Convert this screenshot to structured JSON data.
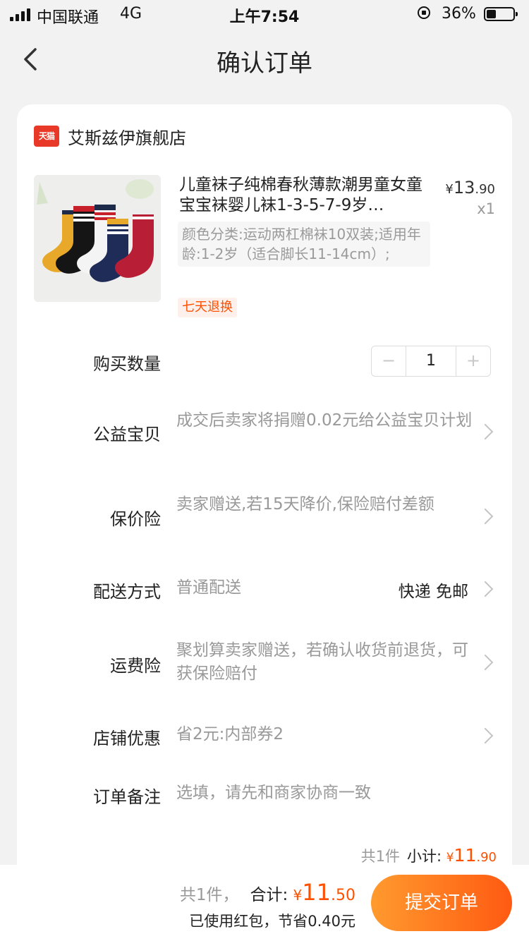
{
  "status": {
    "carrier": "中国联通",
    "network": "4G",
    "time": "上午7:54",
    "battery": "36%",
    "battery_level": 0.36
  },
  "nav": {
    "title": "确认订单"
  },
  "shop": {
    "badge": "天猫",
    "name": "艾斯兹伊旗舰店"
  },
  "product": {
    "title": "儿童袜子纯棉春秋薄款潮男童女童宝宝袜婴儿袜1-3-5-7-9岁…",
    "price_symbol": "¥",
    "price_int": "13",
    "price_dec": ".90",
    "quantity_text": "x1",
    "sku": "颜色分类:运动两杠棉袜10双装;适用年龄:1-2岁（适合脚长11-14cm）;",
    "tag": "七天退换"
  },
  "order": {
    "quantity_label": "购买数量",
    "quantity_value": "1",
    "minus": "−",
    "plus": "+",
    "charity_label": "公益宝贝",
    "charity_value": "成交后卖家将捐赠0.02元给公益宝贝计划",
    "price_protect_label": "保价险",
    "price_protect_value": "卖家赠送,若15天降价,保险赔付差额",
    "delivery_label": "配送方式",
    "delivery_value": "普通配送",
    "delivery_right": "快递 免邮",
    "freight_label": "运费险",
    "freight_value": "聚划算卖家赠送，若确认收货前退货，可获保险赔付",
    "shop_discount_label": "店铺优惠",
    "shop_discount_value": "省2元:内部券2",
    "note_label": "订单备注",
    "note_placeholder": "选填，请先和商家协商一致",
    "subtotal_count": "共1件",
    "subtotal_label": "小计:",
    "subtotal_symbol": "¥",
    "subtotal_int": "11",
    "subtotal_dec": ".90"
  },
  "footer": {
    "count": "共1件，",
    "total_label": "合计:",
    "total_symbol": "¥",
    "total_int": "11",
    "total_dec": ".50",
    "redpacket": "已使用红包，节省0.40元",
    "submit": "提交订单"
  }
}
